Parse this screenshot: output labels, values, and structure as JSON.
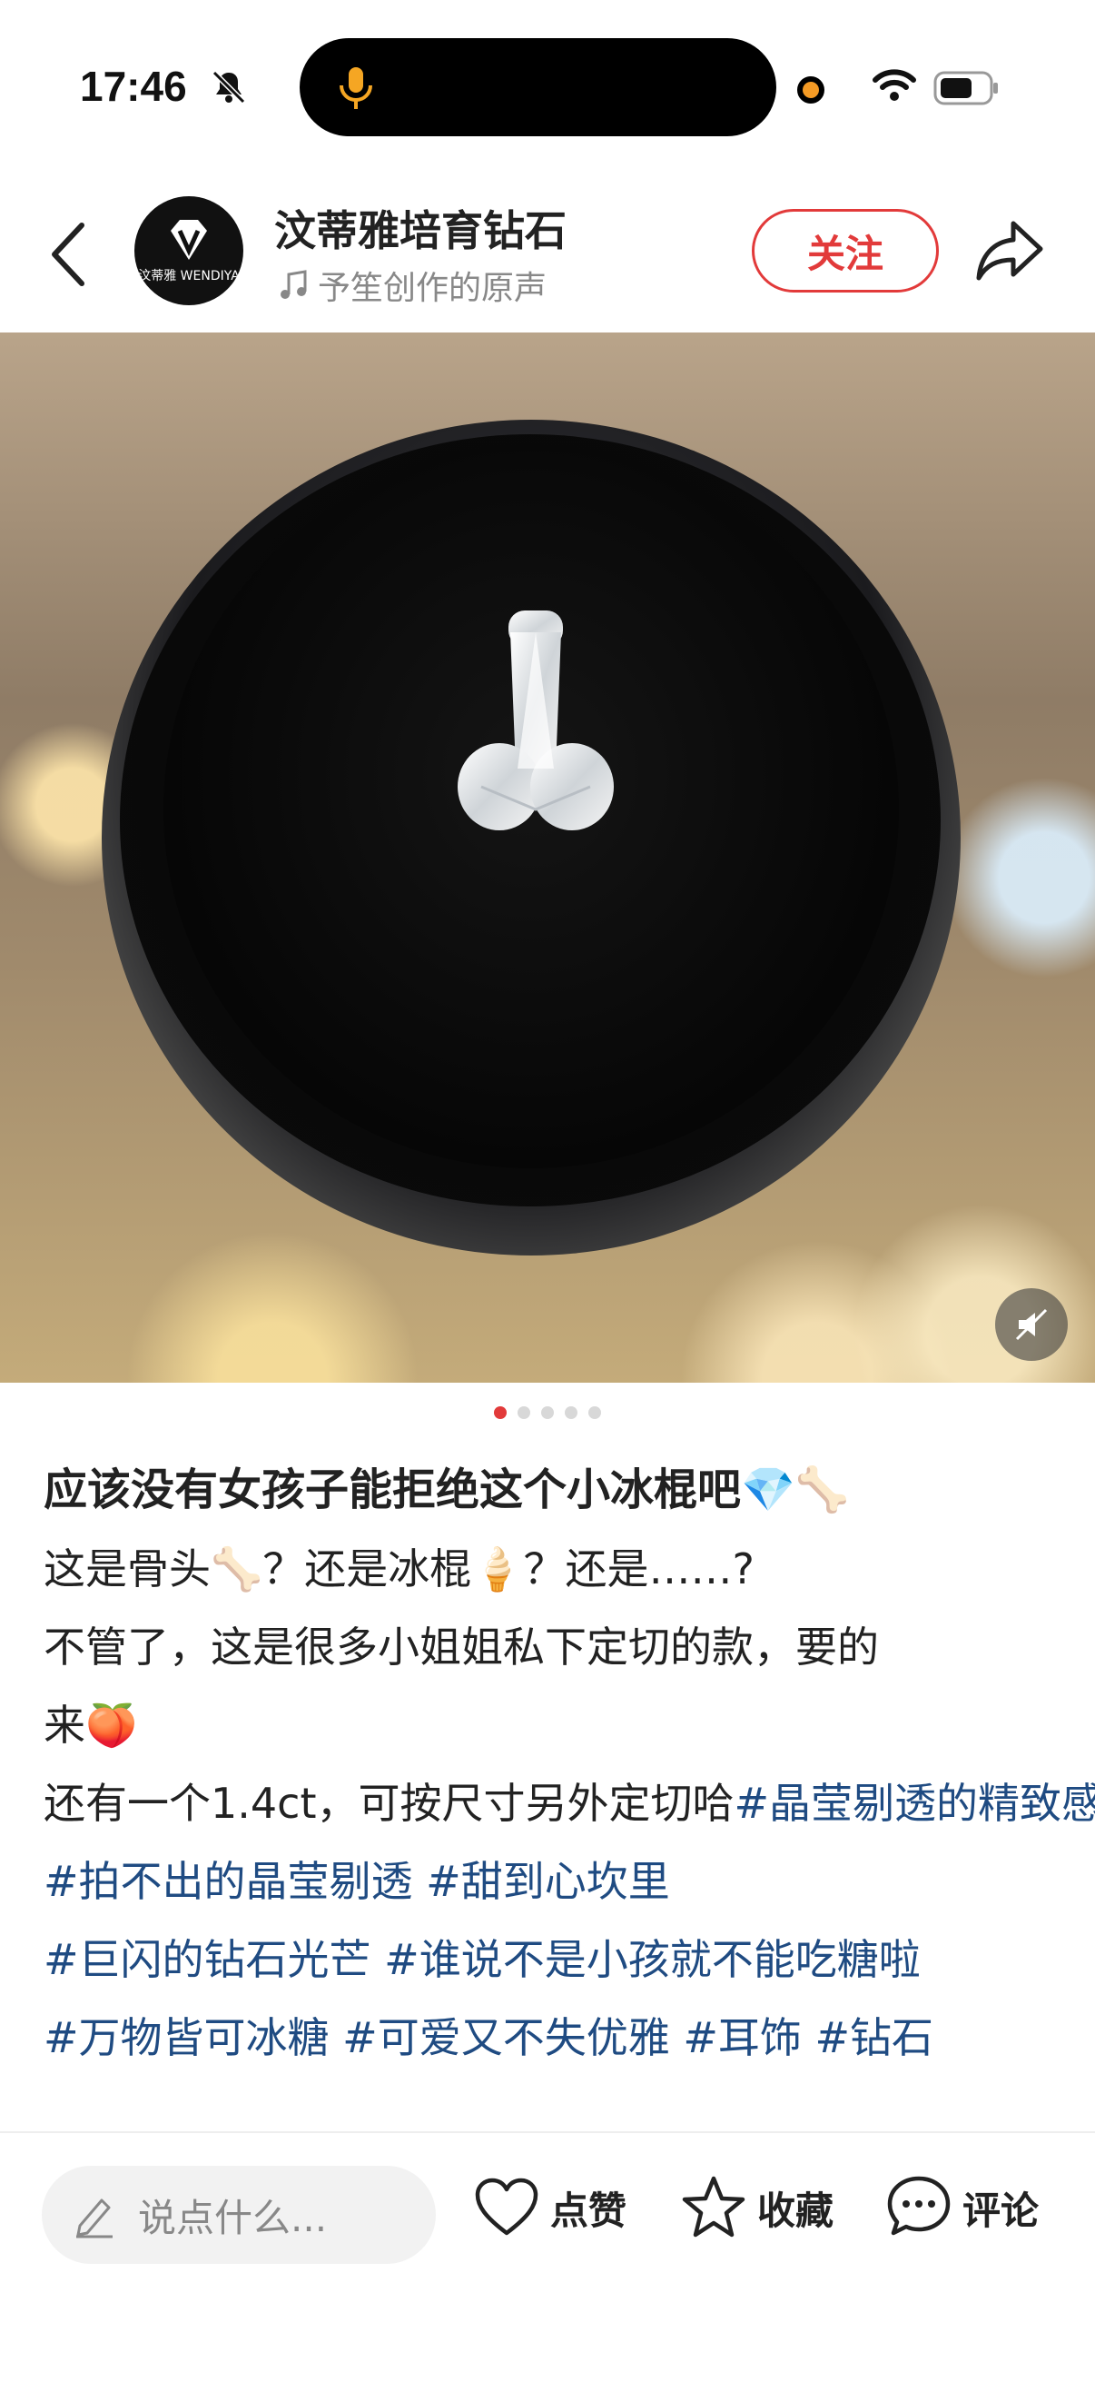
{
  "status_bar": {
    "time": "17:46"
  },
  "header": {
    "author_name": "汶蒂雅培育钻石",
    "avatar_text": "汶蒂雅 WENDIYA",
    "music_text": "予笙创作的原声",
    "follow_label": "关注"
  },
  "carousel": {
    "total_pages": 5,
    "current_page": 1
  },
  "post": {
    "title": "应该没有女孩子能拒绝这个小冰棍吧💎🦴",
    "lines": [
      {
        "text": "这是骨头🦴？还是冰棍🍦？还是……?"
      },
      {
        "text": "不管了，这是很多小姐姐私下定切的款，要的"
      },
      {
        "text": "来🍑"
      }
    ],
    "line4_text": "还有一个1.4ct，可按尺寸另外定切哈",
    "tags": [
      "#晶莹剔透的精致感",
      "#拍不出的晶莹剔透",
      "#甜到心坎里",
      "#巨闪的钻石光芒",
      "#谁说不是小孩就不能吃糖啦",
      "#万物皆可冰糖",
      "#可爱又不失优雅",
      "#耳饰",
      "#钻石"
    ]
  },
  "bottom_bar": {
    "comment_placeholder": "说点什么...",
    "like_label": "点赞",
    "collect_label": "收藏",
    "comment_label": "评论"
  },
  "colors": {
    "accent_red": "#e23a3a",
    "tag_blue": "#1f4b82"
  }
}
